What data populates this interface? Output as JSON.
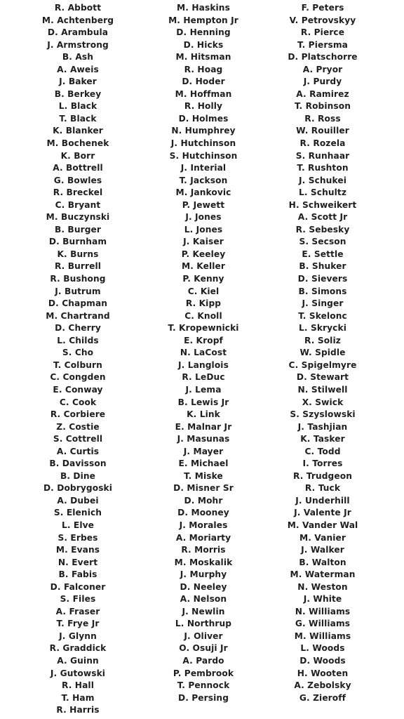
{
  "text_color": "#1f1f1f",
  "background_color": "#ffffff",
  "columns": [
    {
      "names": [
        "R. Abbott",
        "M. Achtenberg",
        "D. Arambula",
        "J. Armstrong",
        "B. Ash",
        "A. Aweis",
        "J. Baker",
        "B. Berkey",
        "L. Black",
        "T. Black",
        "K. Blanker",
        "M. Bochenek",
        "K. Borr",
        "A. Bottrell",
        "G. Bowles",
        "R. Breckel",
        "C. Bryant",
        "M. Buczynski",
        "B. Burger",
        "D. Burnham",
        "K. Burns",
        "R. Burrell",
        "R. Bushong",
        "J. Butrum",
        "D. Chapman",
        "M. Chartrand",
        "D. Cherry",
        "L. Childs",
        "S. Cho",
        "T. Colburn",
        "C. Congden",
        "E. Conway",
        "C. Cook",
        "R. Corbiere",
        "Z. Costie",
        "S. Cottrell",
        "A. Curtis",
        "B. Davisson",
        "B. Dine",
        "D. Dobrygoski",
        "A. Dubei",
        "S. Elenich",
        "L. Elve",
        "S. Erbes",
        "M. Evans",
        "N. Evert",
        "B. Fabis",
        "D. Falconer",
        "S. Files",
        "A. Fraser",
        "T. Frye Jr",
        "J. Glynn",
        "R. Graddick",
        "A. Guinn",
        "J. Gutowski",
        "R. Hall",
        "T. Ham",
        "R. Harris"
      ]
    },
    {
      "names": [
        "M. Haskins",
        "M. Hempton Jr",
        "D. Henning",
        "D. Hicks",
        "M. Hitsman",
        "R. Hoag",
        "D. Hoder",
        "M. Hoffman",
        "R. Holly",
        "D. Holmes",
        "N. Humphrey",
        "J. Hutchinson",
        "S. Hutchinson",
        "J. Interial",
        "T. Jackson",
        "M. Jankovic",
        "P. Jewett",
        "J. Jones",
        "L. Jones",
        "J. Kaiser",
        "P. Keeley",
        "M. Keller",
        "P. Kenny",
        "C. Kiel",
        "R. Kipp",
        "C. Knoll",
        "T. Kropewnicki",
        "E. Kropf",
        "N. LaCost",
        "J. Langlois",
        "R. LeDuc",
        "J. Lema",
        "B. Lewis Jr",
        "K. Link",
        "E. Malnar Jr",
        "J. Masunas",
        "J. Mayer",
        "E. Michael",
        "T. Miske",
        "D. Misner Sr",
        "D. Mohr",
        "D. Mooney",
        "J. Morales",
        "A. Moriarty",
        "R. Morris",
        "M. Moskalik",
        "J. Murphy",
        "D. Neeley",
        "A. Nelson",
        "J. Newlin",
        "L. Northrup",
        "J. Oliver",
        "O. Osuji Jr",
        "A. Pardo",
        "P. Pembrook",
        "T. Pennock",
        "D. Persing"
      ]
    },
    {
      "names": [
        "F. Peters",
        "V. Petrovskyy",
        "R. Pierce",
        "T. Piersma",
        "D. Platschorre",
        "A. Pryor",
        "J. Purdy",
        "A. Ramirez",
        "T. Robinson",
        "R. Ross",
        "W. Rouiller",
        "R. Rozela",
        "S. Runhaar",
        "T. Rushton",
        "J. Schukei",
        "L. Schultz",
        "H. Schweikert",
        "A. Scott Jr",
        "R. Sebesky",
        "S. Secson",
        "E. Settle",
        "B. Shuker",
        "D. Sievers",
        "B. Simons",
        "J. Singer",
        "T. Skelonc",
        "L. Skrycki",
        "R. Soliz",
        "W. Spidle",
        "C. Spigelmyre",
        "D. Stewart",
        "N. Stilwell",
        "X. Swick",
        "S. Szyslowski",
        "J. Tashjian",
        "K. Tasker",
        "C. Todd",
        "I. Torres",
        "R. Trudgeon",
        "R. Tuck",
        "J. Underhill",
        "J. Valente Jr",
        "M. Vander Wal",
        "M. Vanier",
        "J. Walker",
        "B. Walton",
        "M. Waterman",
        "N. Weston",
        "J. White",
        "N. Williams",
        "G. Williams",
        "M. Williams",
        "L. Woods",
        "D. Woods",
        "H. Wooten",
        "A. Zebolsky",
        "G. Zieroff"
      ]
    }
  ]
}
